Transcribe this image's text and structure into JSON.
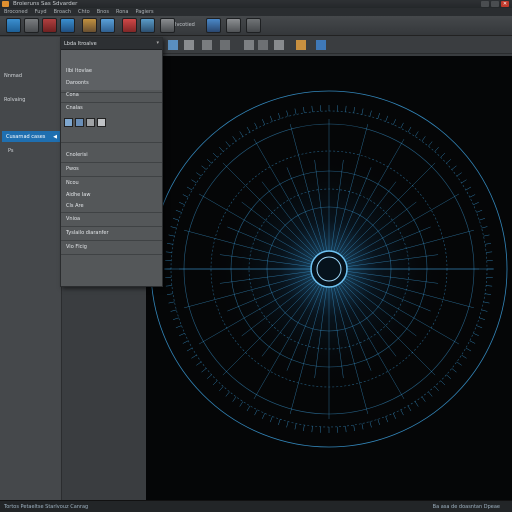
{
  "window": {
    "title": "Broieruns Sas Sdvarder",
    "menu": [
      "Broconed",
      "Fuyd",
      "Broach",
      "Chto",
      "Bnos",
      "Rona",
      "Pagiers"
    ]
  },
  "toolbar": {
    "label": "Ivcotied",
    "icons": [
      "app-icon",
      "brush-icon",
      "layers-icon",
      "cursor-icon",
      "color-icon",
      "grid-icon",
      "image-icon",
      "photo-icon",
      "move-icon",
      "settings-icon"
    ]
  },
  "left_panel": {
    "items": [
      "Nnmad",
      "Rolvaing"
    ],
    "selected": "Cusarnad cases",
    "sub_item": "Ps"
  },
  "dropdown": {
    "header": "Lbda Itroalve",
    "rows": [
      "Ilbi Itovlae",
      "Daroonts",
      "Cona",
      "Cnalas",
      "Cnolerisi",
      "Pwos",
      "Ncou",
      "Aidhe Iaw",
      "Cls Are",
      "Vnioa",
      "Tyslailo diaranfer",
      "Vio Flcig"
    ],
    "icons": [
      "image-icon",
      "layers-icon",
      "brush-icon",
      "settings-icon"
    ]
  },
  "status": {
    "left": "Tortos Petaeltse Starlvouz Canrag",
    "right": "Ba asa de doasntan Dpeae"
  },
  "colors": {
    "accent": "#1f6fb0",
    "radial": "#3fa8e8",
    "canvas_bg": "#050607"
  }
}
